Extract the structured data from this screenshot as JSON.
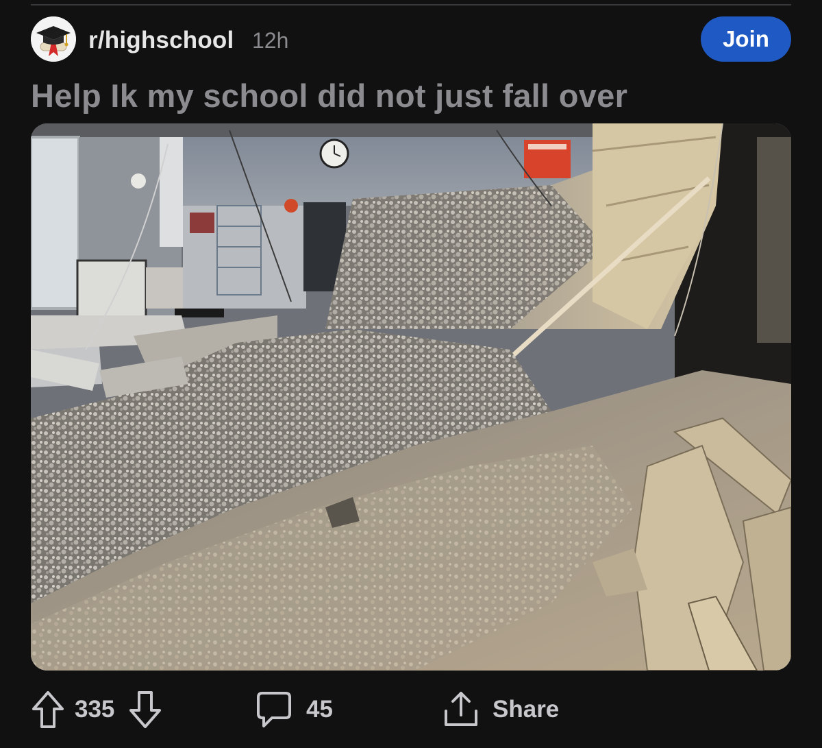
{
  "post": {
    "subreddit": "r/highschool",
    "time_ago": "12h",
    "join_label": "Join",
    "title": "Help Ik my school did not just fall over",
    "image_alt": "Classroom with collapsed ceiling, insulation and debris covering the floor"
  },
  "actions": {
    "upvotes": "335",
    "comments": "45",
    "share_label": "Share"
  },
  "icons": {
    "upvote": "arrow-up-icon",
    "downvote": "arrow-down-icon",
    "comment": "speech-bubble-icon",
    "share": "share-icon",
    "avatar": "graduation-cap-icon"
  },
  "colors": {
    "background": "#111112",
    "join_button": "#1f5ac4",
    "title_text": "#8c8c90",
    "subreddit_text": "#e6e6e6",
    "meta_text": "#8b8b8f",
    "action_text": "#c8c8cc"
  }
}
